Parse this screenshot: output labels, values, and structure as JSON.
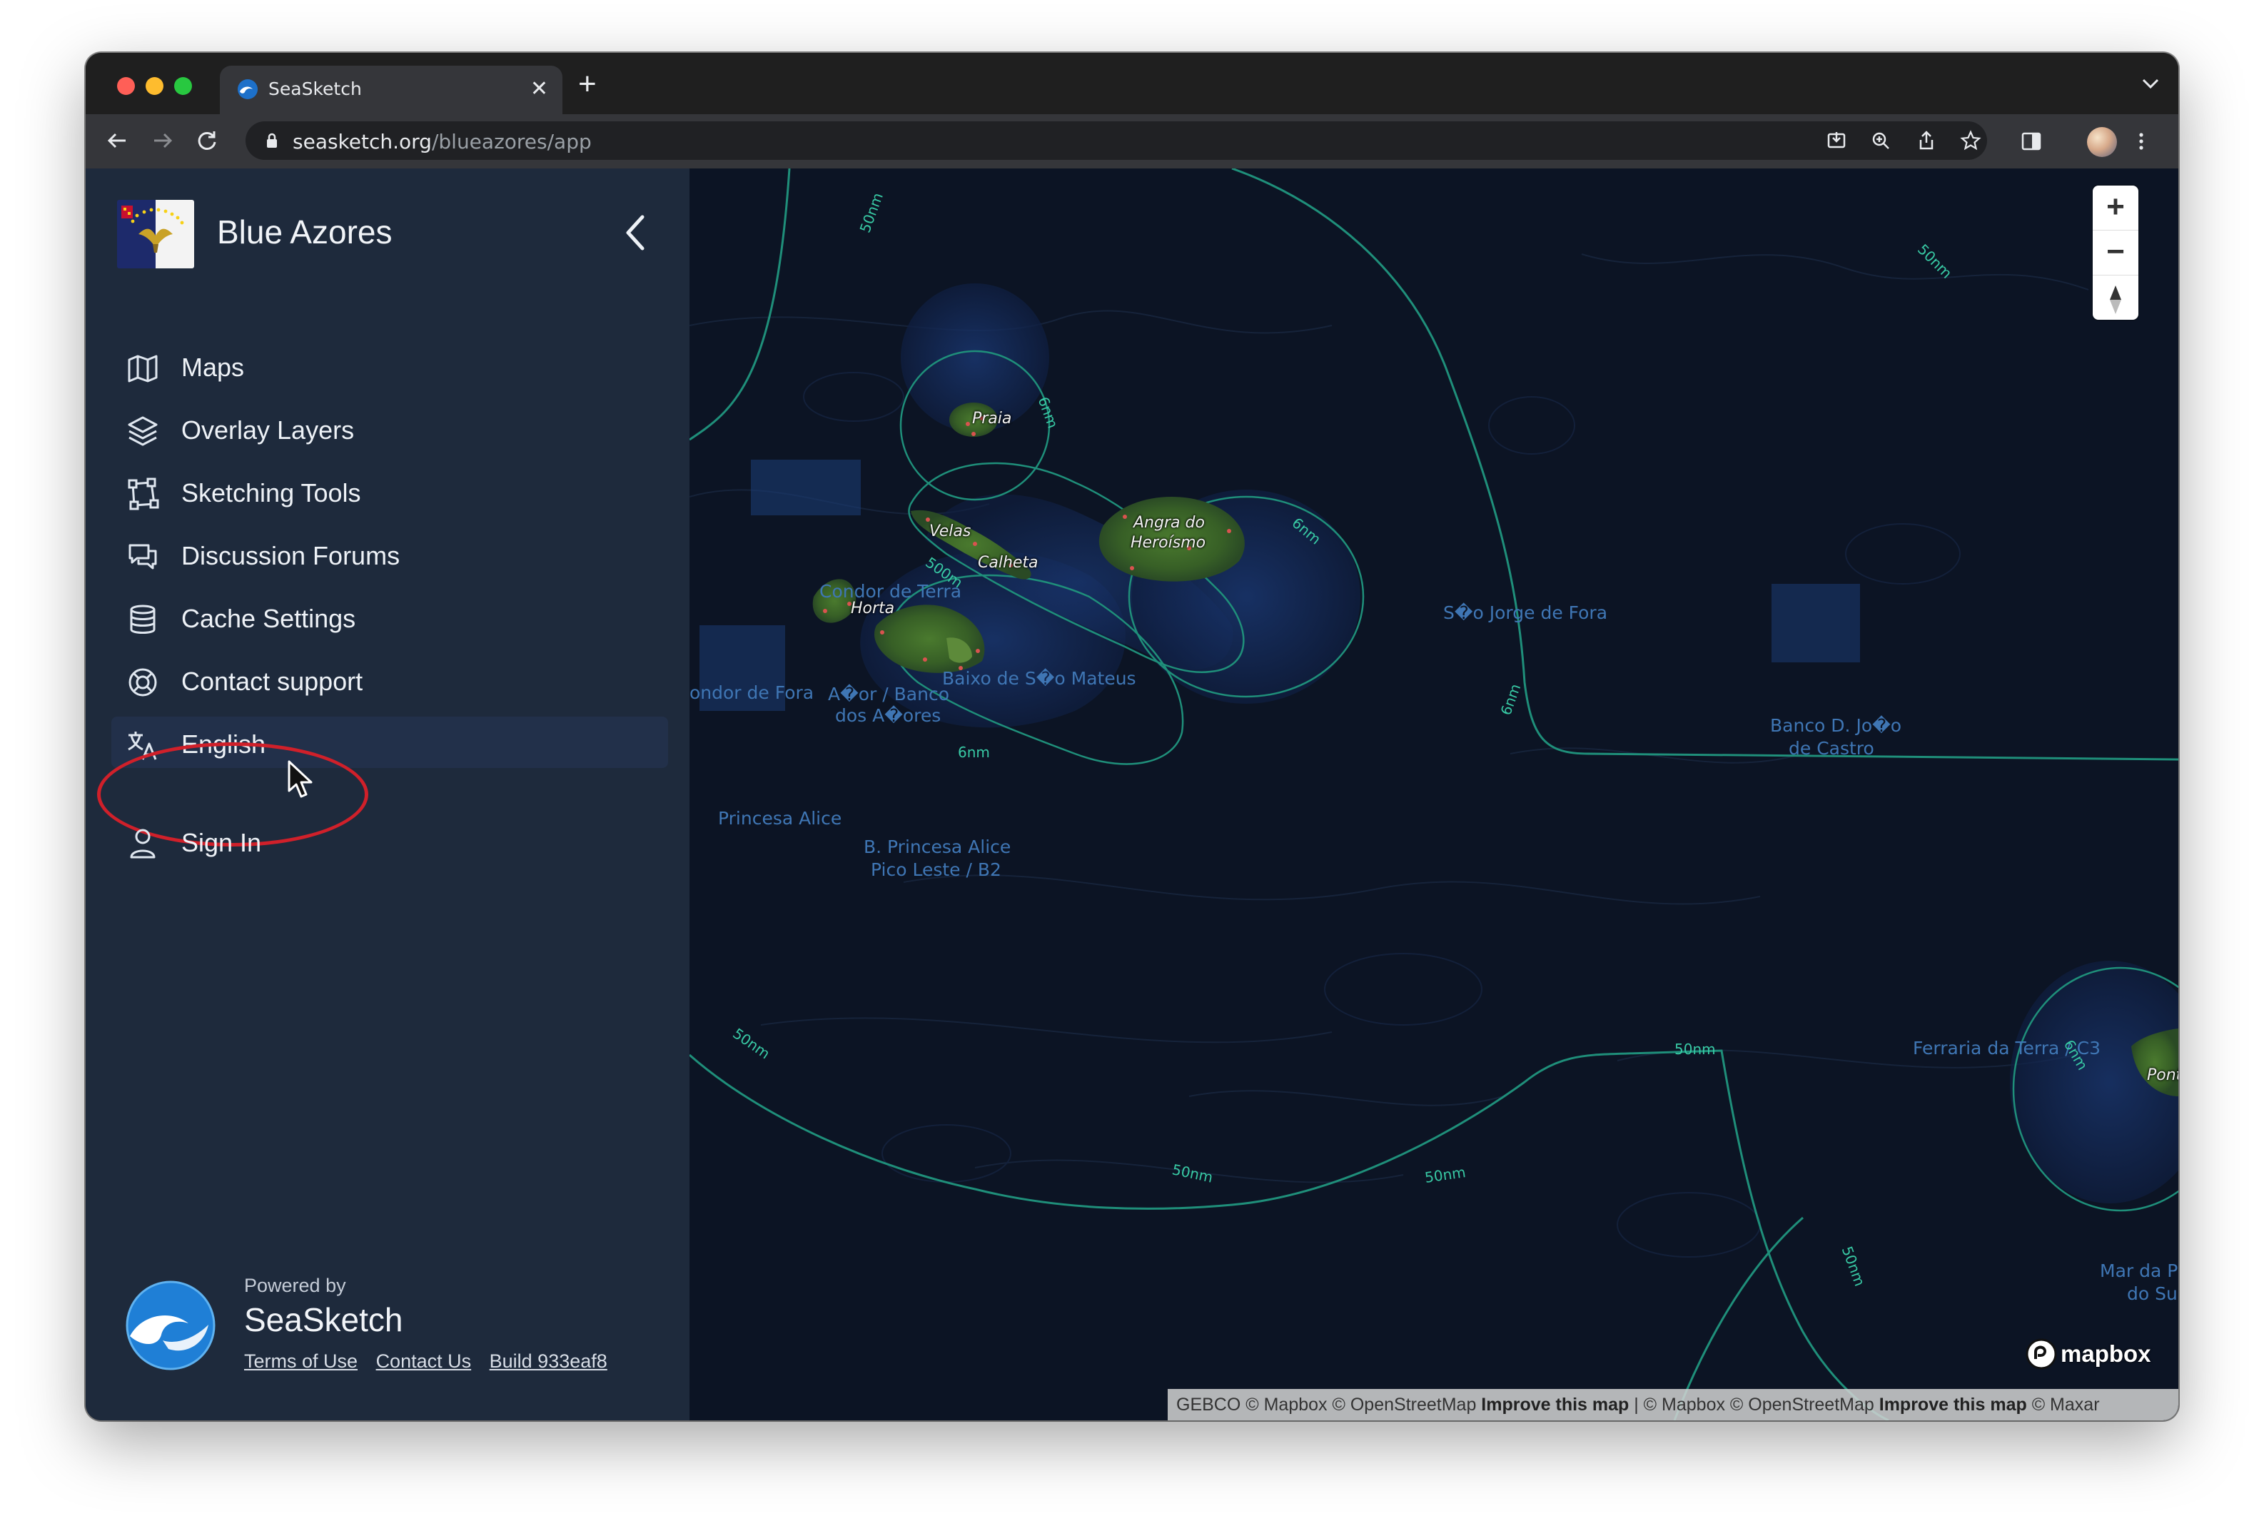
{
  "browser": {
    "tab_title": "SeaSketch",
    "tab_close_icon": "close-icon",
    "new_tab_label": "+",
    "url_domain": "seasketch.org",
    "url_path": "/blueazores/app"
  },
  "sidebar": {
    "project_name": "Blue Azores",
    "items": [
      {
        "label": "Maps",
        "icon": "map-icon"
      },
      {
        "label": "Overlay Layers",
        "icon": "layers-icon"
      },
      {
        "label": "Sketching Tools",
        "icon": "sketch-icon"
      },
      {
        "label": "Discussion Forums",
        "icon": "chat-icon"
      },
      {
        "label": "Cache Settings",
        "icon": "database-icon"
      },
      {
        "label": "Contact support",
        "icon": "support-icon"
      },
      {
        "label": "English",
        "icon": "translate-icon"
      },
      {
        "label": "Sign In",
        "icon": "user-icon"
      }
    ],
    "footer": {
      "powered_by": "Powered by",
      "brand": "SeaSketch",
      "terms": "Terms of Use",
      "contact": "Contact Us",
      "build": "Build 933eaf8"
    }
  },
  "map": {
    "labels": {
      "condor_de_terra": "Condor de Terra",
      "condor_de_fora": "ondor de Fora",
      "baixo_sao_mateus": "Baixo de S�o Mateus",
      "sao_jorge_de_fora": "S�o Jorge de Fora",
      "acor_banco_1": "A�or / Banco",
      "acor_banco_2": "dos A�ores",
      "princesa_alice": "Princesa Alice",
      "b_princesa_1": "B. Princesa Alice",
      "b_princesa_2": "Pico Leste / B2",
      "banco_castro_1": "Banco D. Jo�o",
      "banco_castro_2": "de Castro",
      "ferraria": "Ferraria da Terra / C3",
      "mar_da_1": "Mar da Pr",
      "mar_da_2": "do Su"
    },
    "islands": {
      "praia": "Praia",
      "velas": "Velas",
      "calheta": "Calheta",
      "horta": "Horta",
      "angra_1": "Angra do",
      "angra_2": "Heroísmo",
      "ponta": "Pont"
    },
    "contours": {
      "nm50": "50nm",
      "m6": "6nm",
      "m500": "500m",
      "m6b": "6m"
    },
    "zoom": {
      "in": "+",
      "out": "−"
    },
    "mapbox": "mapbox",
    "attribution": {
      "a": "GEBCO © Mapbox © OpenStreetMap ",
      "b": "Improve this map",
      "c": " | © Mapbox © OpenStreetMap ",
      "d": "Improve this map",
      "e": " © Maxar"
    },
    "colors": {
      "eez_line": "#1f8f7a",
      "sea": "#0c1424",
      "label": "#3f76b4"
    }
  }
}
